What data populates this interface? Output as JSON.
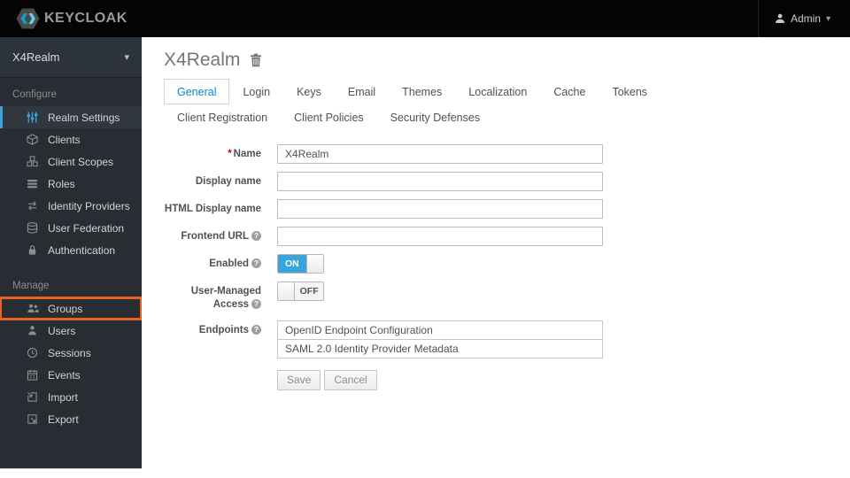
{
  "topbar": {
    "logo_text": "KEYCLOAK",
    "user_label": "Admin"
  },
  "icons": {
    "chevron_down": "▾",
    "help_glyph": "?"
  },
  "sidebar": {
    "realm_selector": {
      "label": "X4Realm"
    },
    "sections": [
      {
        "label": "Configure",
        "items": [
          {
            "label": "Realm Settings",
            "icon": "sliders-icon",
            "active": true
          },
          {
            "label": "Clients",
            "icon": "cube-icon"
          },
          {
            "label": "Client Scopes",
            "icon": "cubes-icon"
          },
          {
            "label": "Roles",
            "icon": "list-icon"
          },
          {
            "label": "Identity Providers",
            "icon": "exchange-icon"
          },
          {
            "label": "User Federation",
            "icon": "database-icon"
          },
          {
            "label": "Authentication",
            "icon": "lock-icon"
          }
        ]
      },
      {
        "label": "Manage",
        "items": [
          {
            "label": "Groups",
            "icon": "group-icon",
            "highlighted": true
          },
          {
            "label": "Users",
            "icon": "user-icon"
          },
          {
            "label": "Sessions",
            "icon": "clock-icon"
          },
          {
            "label": "Events",
            "icon": "calendar-icon"
          },
          {
            "label": "Import",
            "icon": "import-icon"
          },
          {
            "label": "Export",
            "icon": "export-icon"
          }
        ]
      }
    ]
  },
  "main": {
    "title": "X4Realm",
    "tabs": [
      {
        "label": "General",
        "active": true
      },
      {
        "label": "Login"
      },
      {
        "label": "Keys"
      },
      {
        "label": "Email"
      },
      {
        "label": "Themes"
      },
      {
        "label": "Localization"
      },
      {
        "label": "Cache"
      },
      {
        "label": "Tokens"
      },
      {
        "label": "Client Registration"
      },
      {
        "label": "Client Policies"
      },
      {
        "label": "Security Defenses"
      }
    ],
    "form": {
      "name": {
        "label": "Name",
        "required_marker": "*",
        "value": "X4Realm"
      },
      "display_name": {
        "label": "Display name",
        "value": ""
      },
      "html_display_name": {
        "label": "HTML Display name",
        "value": ""
      },
      "frontend_url": {
        "label": "Frontend URL",
        "value": ""
      },
      "enabled": {
        "label": "Enabled",
        "state": "ON"
      },
      "user_managed_access": {
        "label": "User-Managed Access",
        "state": "OFF"
      },
      "endpoints": {
        "label": "Endpoints",
        "links": [
          "OpenID Endpoint Configuration",
          "SAML 2.0 Identity Provider Metadata"
        ]
      },
      "save_label": "Save",
      "cancel_label": "Cancel"
    }
  },
  "colors": {
    "accent_blue": "#0088ce",
    "toggle_on_blue": "#39a5dc",
    "nav_active_border": "#39a5dc",
    "annotation_orange": "#e8641c",
    "topbar_bg": "#040404",
    "sidebar_bg": "#282d33"
  }
}
